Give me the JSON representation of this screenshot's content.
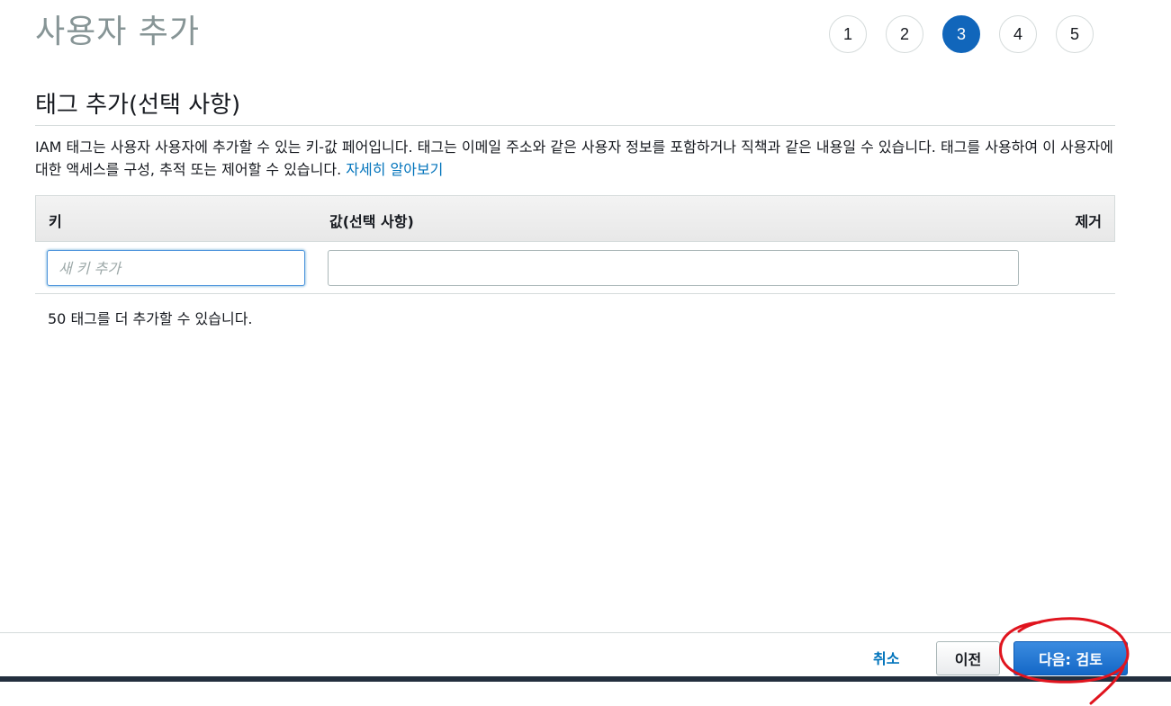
{
  "page": {
    "title": "사용자 추가"
  },
  "steps": [
    "1",
    "2",
    "3",
    "4",
    "5"
  ],
  "active_step": "3",
  "section": {
    "title": "태그 추가(선택 사항)",
    "description": "IAM 태그는 사용자 사용자에 추가할 수 있는 키-값 페어입니다. 태그는 이메일 주소와 같은 사용자 정보를 포함하거나 직책과 같은 내용일 수 있습니다. 태그를 사용하여 이 사용자에 대한 액세스를 구성, 추적 또는 제어할 수 있습니다.",
    "learn_more_link": "자세히 알아보기"
  },
  "table": {
    "headers": {
      "key": "키",
      "value": "값(선택 사항)",
      "remove": "제거"
    },
    "row": {
      "key_placeholder": "새 키 추가",
      "key_value": "",
      "value_value": ""
    }
  },
  "remaining_text": "50 태그를 더 추가할 수 있습니다.",
  "footer": {
    "cancel_label": "취소",
    "previous_label": "이전",
    "next_label": "다음: 검토"
  },
  "colors": {
    "active_step": "#1166bb",
    "link": "#0073bb",
    "primary_button": "#1468c7",
    "annotation": "#e0141e"
  }
}
